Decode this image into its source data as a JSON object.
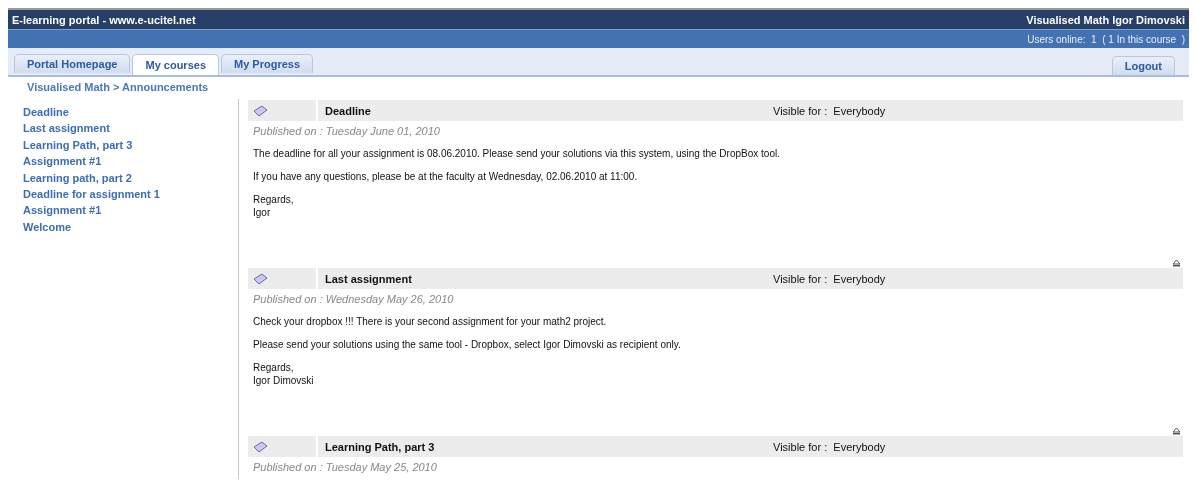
{
  "header": {
    "site_title": "E-learning portal - www.e-ucitel.net",
    "user_title": "Visualised Math Igor Dimovski"
  },
  "status_bar": {
    "users_online": "Users online:  1  ( 1 In this course  )"
  },
  "tabs": [
    {
      "label": "Portal Homepage",
      "selected": false
    },
    {
      "label": "My courses",
      "selected": true
    },
    {
      "label": "My Progress",
      "selected": false
    }
  ],
  "logout": "Logout",
  "breadcrumb": "Visualised Math > Announcements",
  "sidebar": {
    "items": [
      "Deadline",
      "Last assignment",
      "Learning Path, part 3",
      "Assignment #1",
      "Learning path, part 2",
      "Deadline for assignment 1",
      "Assignment #1",
      "Welcome"
    ]
  },
  "announcements": [
    {
      "title": "Deadline",
      "visible_label": "Visible for :",
      "visible_value": "Everybody",
      "published": "Published on : Tuesday June 01, 2010",
      "paragraphs": [
        "The deadline for all your assignment is 08.06.2010. Please send your solutions via this system, using the DropBox tool.",
        "If you have any questions, please be at the faculty at Wednesday, 02.06.2010 at 11:00.",
        "Regards,\nIgor"
      ]
    },
    {
      "title": "Last assignment",
      "visible_label": "Visible for :",
      "visible_value": "Everybody",
      "published": "Published on : Wednesday May 26, 2010",
      "paragraphs": [
        "Check your dropbox !!! There is your second assignment for your math2 project.",
        "Please send your solutions using the same tool - Dropbox, select Igor Dimovski as recipient only.",
        "Regards,\nIgor Dimovski"
      ]
    },
    {
      "title": "Learning Path, part 3",
      "visible_label": "Visible for :",
      "visible_value": "Everybody",
      "published": "Published on : Tuesday May 25, 2010"
    }
  ]
}
